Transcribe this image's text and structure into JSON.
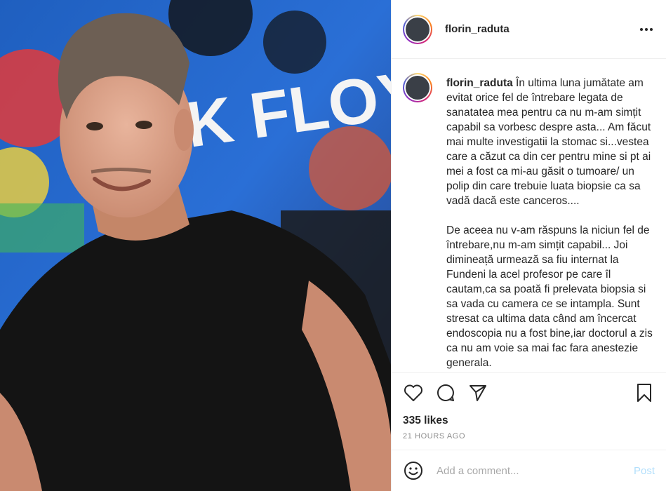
{
  "post": {
    "username": "florin_raduta",
    "more_icon": "more-horizontal-icon",
    "caption_paragraphs": [
      "În ultima luna jumătate am evitat orice fel de întrebare legata de sanatatea mea pentru ca nu m-am simțit capabil sa vorbesc despre asta... Am făcut mai multe investigatii la stomac si...vestea care a căzut ca din cer pentru mine si pt ai mei a fost ca mi-au găsit o tumoare/ un polip din care trebuie luata biopsie ca sa vadă dacă este canceros....",
      "De aceea nu v-am răspuns la niciun fel de întrebare,nu m-am simțit capabil... Joi dimineață urmează sa fiu internat la Fundeni la acel profesor pe care îl cautam,ca sa poată fi prelevata biopsia si sa vada cu camera ce se intampla. Sunt stresat ca ultima data când am încercat endoscopia nu a fost bine,iar doctorul a zis ca nu am voie sa mai fac fara anestezie generala."
    ],
    "photo_sign_text": "K FLOYD",
    "likes": "335 likes",
    "timestamp": "21 HOURS AGO",
    "comment_placeholder": "Add a comment...",
    "post_label": "Post"
  },
  "icons": {
    "like": "heart-icon",
    "comment": "comment-icon",
    "share": "paper-plane-icon",
    "save": "bookmark-icon",
    "emoji": "emoji-icon"
  },
  "colors": {
    "text": "#262626",
    "muted": "#8e8e8e",
    "border": "#efefef",
    "post_disabled": "#b2dffc"
  }
}
